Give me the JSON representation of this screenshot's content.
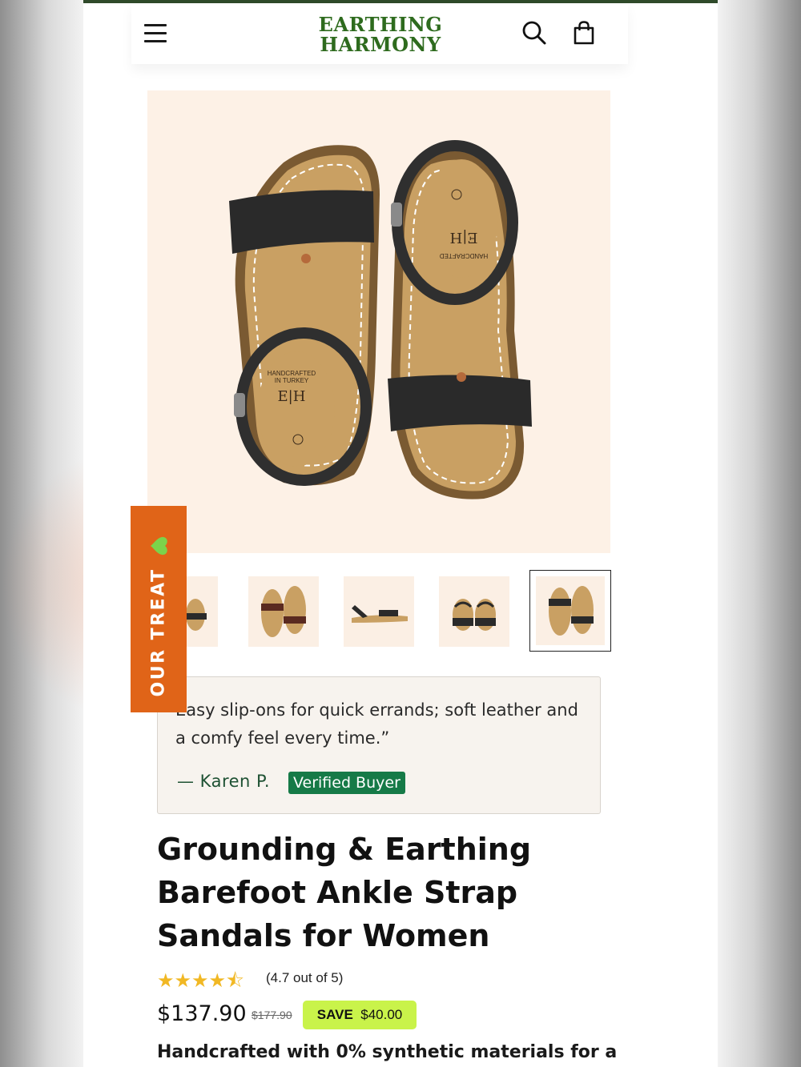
{
  "brand": {
    "logo_line1": "EARTHING",
    "logo_line2": "HARMONY"
  },
  "header": {
    "menu_icon": "hamburger-menu-icon",
    "search_icon": "search-icon",
    "cart_icon": "shopping-bag-icon"
  },
  "gallery": {
    "main_image": "product-image-sandals-top-view",
    "thumbnail_count": 5,
    "selected_thumbnail": 5
  },
  "promo_tab": {
    "label": "OUR TREAT",
    "icon": "green-heart-icon"
  },
  "review": {
    "quote": "Easy slip-ons for quick errands; soft leather and a comfy feel every time.”",
    "author": "— Karen P.",
    "badge": "Verified Buyer"
  },
  "product": {
    "title_line1": "Grounding & Earthing",
    "title_line2": "Barefoot Ankle Strap",
    "title_line3": "Sandals for Women",
    "stars": "★★★★⯪",
    "rating": 4.7,
    "rating_text": "(4.7 out of 5)",
    "price": "$137.90",
    "compare_price": "$177.90",
    "save_label": "SAVE",
    "save_amount": "$40.00",
    "description_start": "Handcrafted with 0% synthetic materials for a"
  },
  "colors": {
    "brand_green": "#2e6b1e",
    "accent_orange": "#e06418",
    "badge_green": "#167a47",
    "save_lime": "#c9f34a",
    "star_gold": "#f1b824"
  }
}
